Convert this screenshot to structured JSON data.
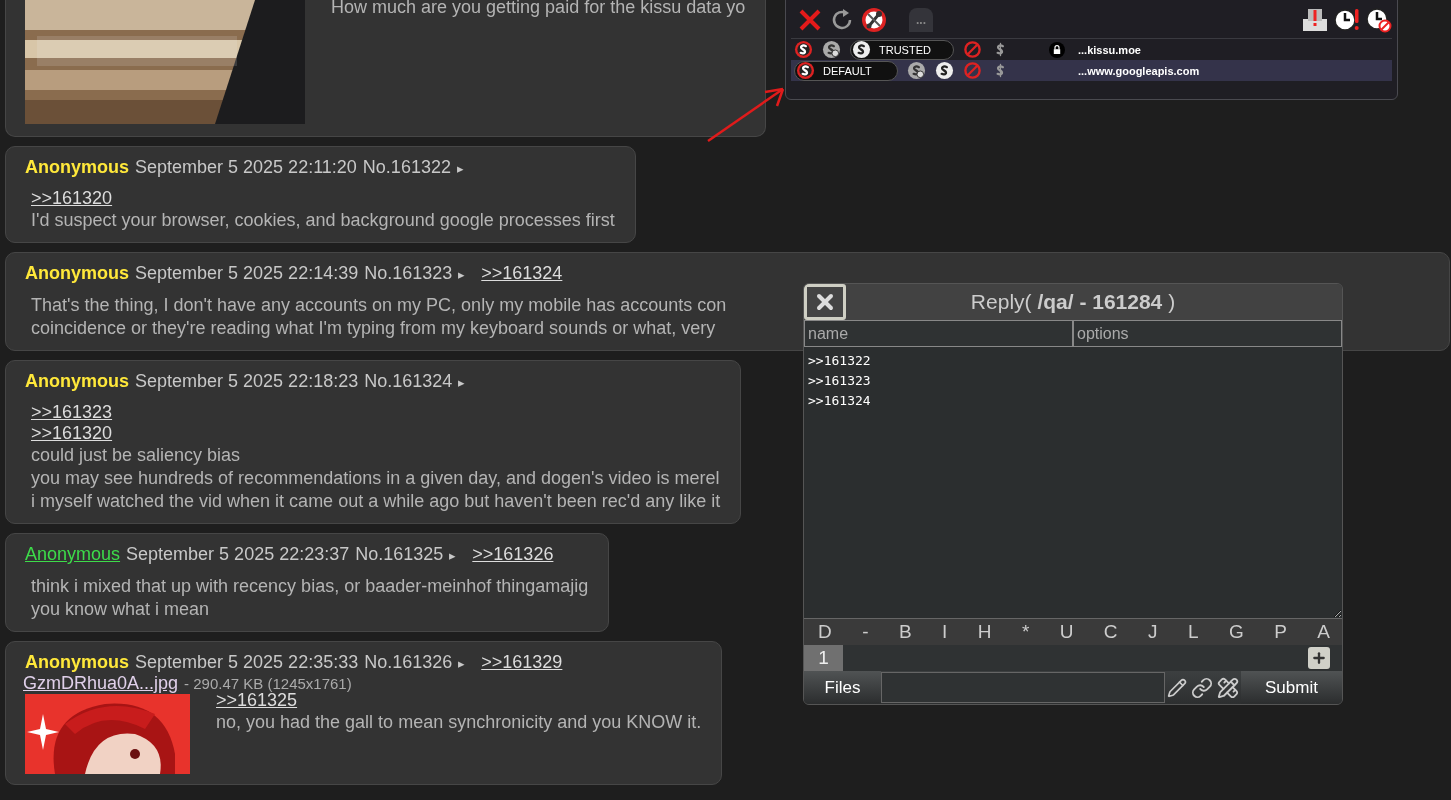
{
  "posts": [
    {
      "thumbnail": {
        "kind": "picture"
      },
      "body": [
        {
          "kind": "text",
          "text": "How much are you getting paid for the kissu data yo"
        }
      ]
    },
    {
      "name": "Anonymous",
      "email_link": false,
      "date": "September 5 2025 22:11:20",
      "number": "No.161322",
      "marker": "▸",
      "body": [
        {
          "kind": "quote",
          "text": ">>161320"
        },
        {
          "kind": "text",
          "text": "I'd suspect your browser, cookies, and background google processes first"
        }
      ]
    },
    {
      "name": "Anonymous",
      "email_link": false,
      "date": "September 5 2025 22:14:39",
      "number": "No.161323",
      "marker": "▸",
      "replies": [
        ">>161324"
      ],
      "wide": true,
      "body": [
        {
          "kind": "text",
          "text": "That's the thing, I don't have any accounts on my PC, only my mobile has accounts con"
        },
        {
          "kind": "text",
          "text": "coincidence or they're reading what I'm typing from my keyboard sounds or what, very"
        }
      ]
    },
    {
      "name": "Anonymous",
      "email_link": false,
      "date": "September 5 2025 22:18:23",
      "number": "No.161324",
      "marker": "▸",
      "body": [
        {
          "kind": "quote",
          "text": ">>161323"
        },
        {
          "kind": "quote",
          "text": ">>161320"
        },
        {
          "kind": "text",
          "text": "could just be saliency bias"
        },
        {
          "kind": "text",
          "text": "you may see hundreds of recommendations in a given day, and dogen's video is merel"
        },
        {
          "kind": "text",
          "text": "i myself watched the vid when it came out a while ago but haven't been rec'd any like it"
        }
      ]
    },
    {
      "name": "Anonymous",
      "email_link": true,
      "date": "September 5 2025 22:23:37",
      "number": "No.161325",
      "marker": "▸",
      "replies": [
        ">>161326"
      ],
      "body": [
        {
          "kind": "text",
          "text": "think i mixed that up with recency bias, or baader-meinhof thingamajig"
        },
        {
          "kind": "text",
          "text": "you know what i mean"
        }
      ]
    },
    {
      "name": "Anonymous",
      "email_link": false,
      "date": "September 5 2025 22:35:33",
      "number": "No.161326",
      "marker": "▸",
      "replies": [
        ">>161329"
      ],
      "file": {
        "filename": "GzmDRhua0A...jpg",
        "info": "- 290.47 KB (1245x1761)"
      },
      "thumbnail": {
        "kind": "picture"
      },
      "body": [
        {
          "kind": "quote",
          "text": ">>161325"
        },
        {
          "kind": "text",
          "text": "no, you had the gall to mean synchronicity and you KNOW it."
        }
      ]
    }
  ],
  "noscript": {
    "tools": [
      {
        "kind": "close"
      },
      {
        "kind": "reload"
      },
      {
        "kind": "options"
      },
      {
        "kind": "more",
        "text": "..."
      }
    ],
    "right_tools": [
      {
        "kind": "warning"
      },
      {
        "kind": "temp-trust"
      },
      {
        "kind": "revoke"
      }
    ],
    "sites": [
      {
        "domain": "...kissu.moe",
        "secure": true,
        "highlighted": false,
        "presets": [
          {
            "kind": "default",
            "selected": false
          },
          {
            "kind": "temp",
            "selected": false
          },
          {
            "kind": "trusted",
            "selected": true,
            "label": "TRUSTED"
          },
          {
            "kind": "untrusted",
            "selected": false
          },
          {
            "kind": "custom",
            "selected": false
          }
        ]
      },
      {
        "domain": "...www.googleapis.com",
        "secure": false,
        "highlighted": true,
        "presets": [
          {
            "kind": "default",
            "selected": true,
            "label": "DEFAULT"
          },
          {
            "kind": "temp",
            "selected": false
          },
          {
            "kind": "trusted",
            "selected": false
          },
          {
            "kind": "untrusted",
            "selected": false
          },
          {
            "kind": "custom",
            "selected": false
          }
        ]
      }
    ]
  },
  "reply": {
    "title": "Reply( **/qa/ - 161284** )",
    "name_placeholder": "name",
    "options_placeholder": "options",
    "message": ">>161322\n>>161323\n>>161324",
    "format_buttons": [
      "D",
      "-",
      "B",
      "I",
      "H",
      "*",
      "U",
      "C",
      "J",
      "L",
      "G",
      "P",
      "A"
    ],
    "file_tabs": [
      {
        "label": "1",
        "selected": true
      }
    ],
    "files_button": "Files",
    "submit": "Submit"
  }
}
